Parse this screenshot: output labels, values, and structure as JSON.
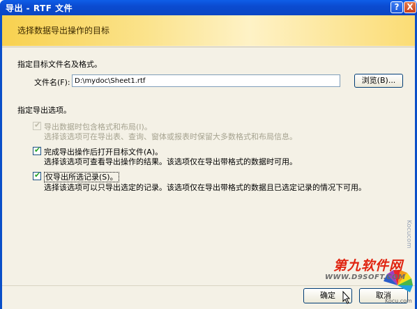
{
  "window": {
    "title": "导出 - RTF 文件",
    "help_label": "?",
    "close_label": "X"
  },
  "banner": {
    "title": "选择数据导出操作的目标"
  },
  "file_section": {
    "heading": "指定目标文件名及格式。",
    "filename_label": "文件名(F):",
    "filename_value": "D:\\mydoc\\Sheet1.rtf",
    "browse_label": "浏览(B)..."
  },
  "options_section": {
    "heading": "指定导出选项。",
    "options": [
      {
        "label": "导出数据时包含格式和布局(I)。",
        "description": "选择该选项可在导出表、查询、窗体或报表时保留大多数格式和布局信息。",
        "checked": true,
        "enabled": false
      },
      {
        "label": "完成导出操作后打开目标文件(A)。",
        "description": "选择该选项可查看导出操作的结果。该选项仅在导出带格式的数据时可用。",
        "checked": true,
        "enabled": true
      },
      {
        "label": "仅导出所选记录(S)。",
        "description": "选择该选项可以只导出选定的记录。该选项仅在导出带格式的数据且已选定记录的情况下可用。",
        "checked": true,
        "enabled": true
      }
    ]
  },
  "footer": {
    "ok_label": "确定",
    "cancel_label": "取消"
  },
  "watermark": {
    "brand": "第九软件网",
    "url": "WWW.D9SOFT.COM",
    "side": "Kocucom",
    "small": "Kocu.com"
  },
  "colors": {
    "titlebar": "#0b4bd1",
    "banner_gold": "#f8d14f",
    "client_bg": "#f4f1e6",
    "checkbox_tick": "#21a121",
    "watermark_red": "#e02410"
  },
  "icons": {
    "check": "check-icon",
    "cursor": "mouse-pointer-icon",
    "logo": "colorful-fan-logo-icon"
  }
}
